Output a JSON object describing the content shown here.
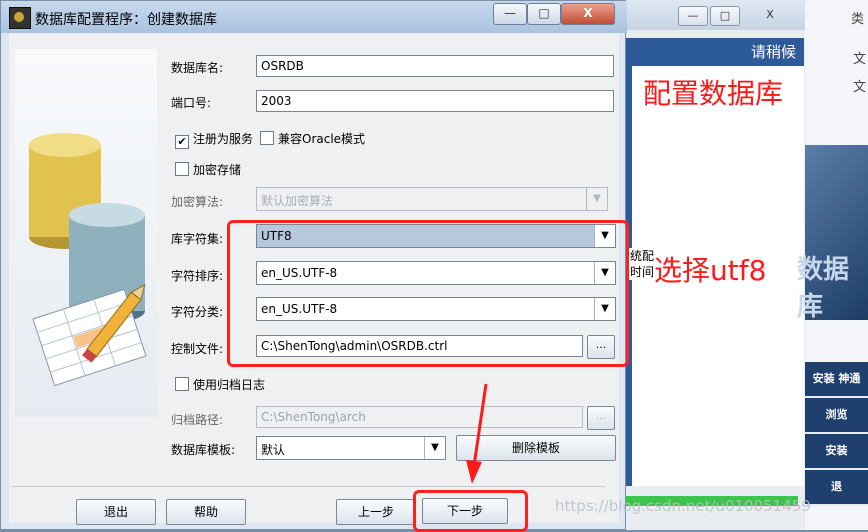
{
  "dialog": {
    "title": "数据库配置程序：创建数据库",
    "fields": {
      "db_name_label": "数据库名:",
      "db_name_value": "OSRDB",
      "port_label": "端口号:",
      "port_value": "2003",
      "register_service_label": "注册为服务",
      "oracle_compat_label": "兼容Oracle模式",
      "encrypt_storage_label": "加密存储",
      "encrypt_algo_label": "加密算法:",
      "encrypt_algo_value": "默认加密算法",
      "charset_label": "库字符集:",
      "charset_value": "UTF8",
      "collation_label": "字符排序:",
      "collation_value": "en_US.UTF-8",
      "ctype_label": "字符分类:",
      "ctype_value": "en_US.UTF-8",
      "control_file_label": "控制文件:",
      "control_file_value": "C:\\ShenTong\\admin\\OSRDB.ctrl",
      "browse_label": "...",
      "archive_log_label": "使用归档日志",
      "archive_path_label": "归档路径:",
      "archive_path_value": "C:\\ShenTong\\arch",
      "archive_browse_label": "...",
      "template_label": "数据库模板:",
      "template_value": "默认",
      "delete_template_label": "删除模板"
    },
    "buttons": {
      "exit": "退出",
      "help": "帮助",
      "prev": "上一步",
      "next": "下一步"
    },
    "window_controls": {
      "minimize": "—",
      "maximize": "□",
      "close": "X"
    }
  },
  "background": {
    "window_header": "请稍候",
    "fragment": "系统配\n却时间",
    "right_items": [
      "安装 神通",
      "浏览",
      "安装",
      "退"
    ],
    "right_texts": [
      "文",
      "文"
    ],
    "top_right_text": "类",
    "banner_text": "数据库"
  },
  "annotations": {
    "config_db": "配置数据库",
    "select_utf8": "选择utf8",
    "watermark": "https://blog.csdn.net/u010051459"
  },
  "colors": {
    "annotation": "#ff1a1a",
    "titlebar": "#b8cde6",
    "progress": "#3cc54a"
  }
}
